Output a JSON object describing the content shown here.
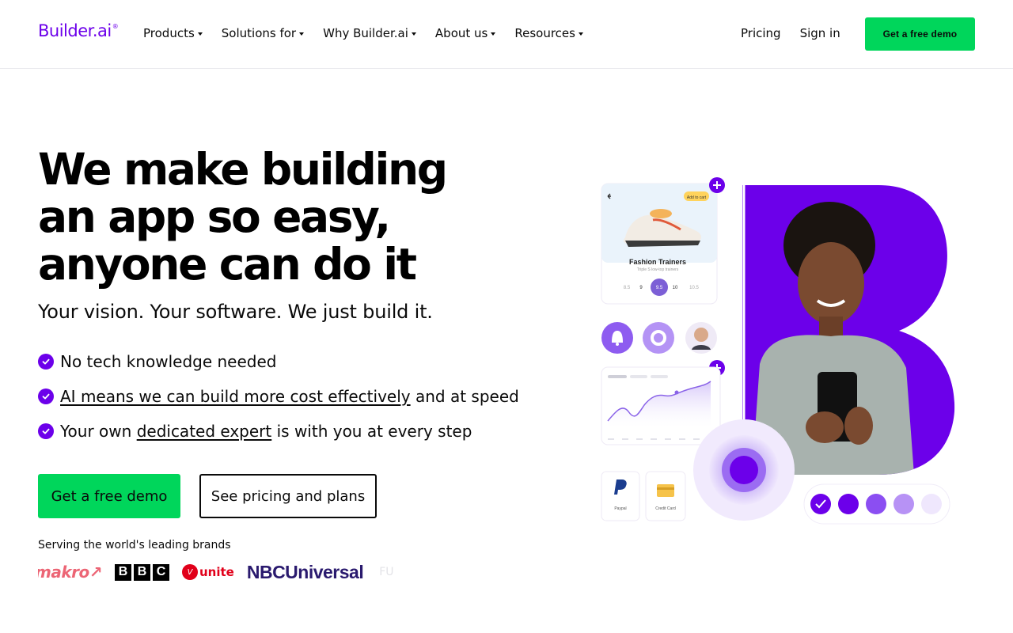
{
  "header": {
    "logo_text": "Builder.ai",
    "logo_reg": "®",
    "nav": [
      {
        "label": "Products"
      },
      {
        "label": "Solutions for"
      },
      {
        "label": "Why Builder.ai"
      },
      {
        "label": "About us"
      },
      {
        "label": "Resources"
      }
    ],
    "pricing_label": "Pricing",
    "signin_label": "Sign in",
    "demo_label": "Get a free demo"
  },
  "hero": {
    "title": "We make building an app so easy, anyone can do it",
    "subtitle": "Your vision. Your software. We just build it.",
    "features": [
      {
        "link": "",
        "text": "No tech knowledge needed"
      },
      {
        "prefix": "",
        "link": "AI means we can build more cost effectively",
        "suffix": " and at speed"
      },
      {
        "prefix": "Your own ",
        "link": "dedicated expert",
        "suffix": " is with you at every step"
      }
    ],
    "demo_button": "Get a free demo",
    "pricing_button": "See pricing and plans",
    "brands_label": "Serving the world's leading brands",
    "brands": {
      "makro": "makro↗",
      "bbc": [
        "B",
        "B",
        "C"
      ],
      "virgin_mark": "V",
      "virgin_text": "unite",
      "nbc": "NBCUniversal",
      "fade": "FU"
    }
  },
  "illustration": {
    "card_cart_label": "Add to cart",
    "product_title": "Fashion Trainers",
    "product_sub": "Triple S low-top trainers",
    "sizes": [
      "8.5",
      "9",
      "9.5",
      "10",
      "10.5"
    ],
    "selected_size": "9.5",
    "paypal_label": "Paypal",
    "card_label": "Credit Card",
    "colors": {
      "brand_purple": "#6c00ea",
      "cta_green": "#00d65b"
    }
  }
}
